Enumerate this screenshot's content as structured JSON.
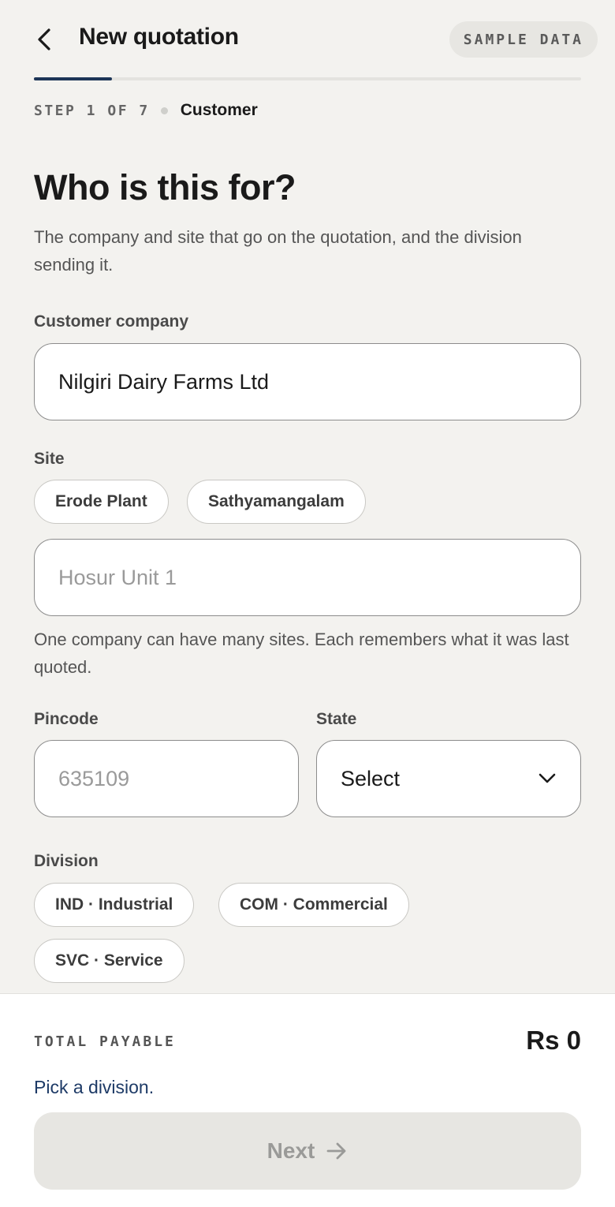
{
  "header": {
    "title": "New quotation",
    "badge": "SAMPLE DATA",
    "progress": 0.143
  },
  "step": {
    "count": "STEP 1 OF 7",
    "name": "Customer"
  },
  "intro": {
    "headline": "Who is this for?",
    "description": "The company and site that go on the quotation, and the division sending it."
  },
  "customer": {
    "label": "Customer company",
    "value": "Nilgiri Dairy Farms Ltd"
  },
  "site": {
    "label": "Site",
    "chips": [
      "Erode Plant",
      "Sathyamangalam"
    ],
    "placeholder": "Hosur Unit 1",
    "hint": "One company can have many sites. Each remembers what it was last quoted."
  },
  "pincode": {
    "label": "Pincode",
    "placeholder": "635109"
  },
  "state": {
    "label": "State",
    "value": "Select"
  },
  "division": {
    "label": "Division",
    "chips": [
      "IND · Industrial",
      "COM · Commercial",
      "SVC · Service"
    ]
  },
  "footer": {
    "total_label": "TOTAL PAYABLE",
    "total_value": "Rs 0",
    "hint": "Pick a division.",
    "next_label": "Next"
  },
  "colors": {
    "accent": "#1d3557",
    "background": "#f3f2ef"
  }
}
